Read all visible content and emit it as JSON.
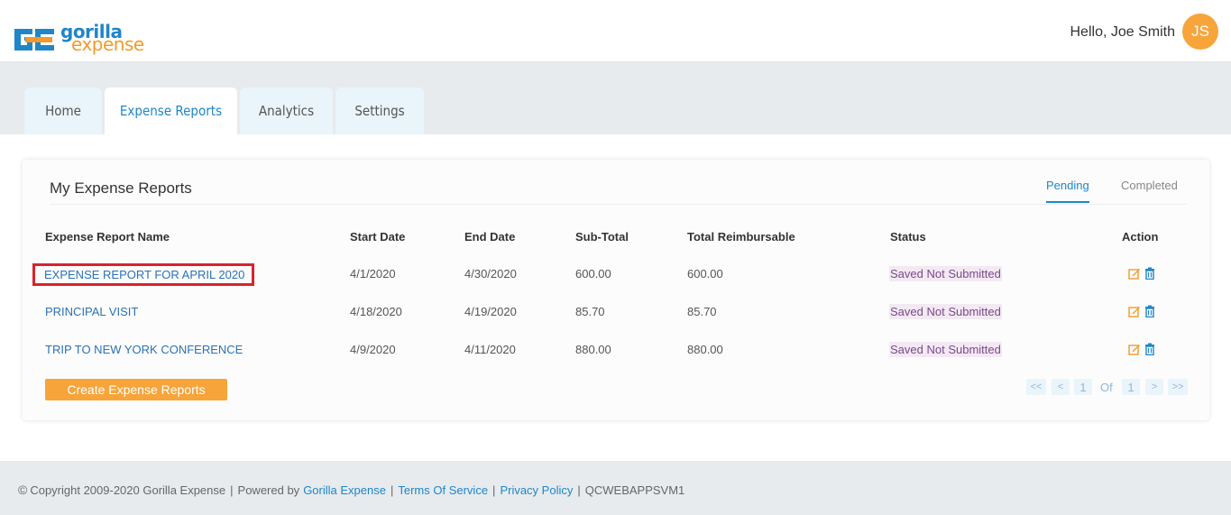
{
  "header": {
    "logo_top": "gorilla",
    "logo_bottom": "expense",
    "greeting": "Hello, Joe Smith",
    "avatar_initials": "JS"
  },
  "tabs": [
    {
      "label": "Home",
      "active": false
    },
    {
      "label": "Expense Reports",
      "active": true
    },
    {
      "label": "Analytics",
      "active": false
    },
    {
      "label": "Settings",
      "active": false
    }
  ],
  "card": {
    "title": "My Expense Reports",
    "status_tabs": {
      "pending": "Pending",
      "completed": "Completed"
    },
    "columns": [
      "Expense Report Name",
      "Start Date",
      "End Date",
      "Sub-Total",
      "Total Reimbursable",
      "Status",
      "Action"
    ],
    "rows": [
      {
        "name": "EXPENSE REPORT FOR APRIL 2020",
        "start": "4/1/2020",
        "end": "4/30/2020",
        "subtotal": "600.00",
        "total": "600.00",
        "status": "Saved Not Submitted"
      },
      {
        "name": "PRINCIPAL VISIT",
        "start": "4/18/2020",
        "end": "4/19/2020",
        "subtotal": "85.70",
        "total": "85.70",
        "status": "Saved Not Submitted"
      },
      {
        "name": "TRIP TO NEW YORK CONFERENCE",
        "start": "4/9/2020",
        "end": "4/11/2020",
        "subtotal": "880.00",
        "total": "880.00",
        "status": "Saved Not Submitted"
      }
    ],
    "create_button": "Create Expense Reports",
    "pagination": {
      "first": "<<",
      "prev": "<",
      "current": "1",
      "of": "Of",
      "total": "1",
      "next": ">",
      "last": ">>"
    }
  },
  "footer": {
    "copyright_symbol": "©",
    "copyright": "Copyright 2009-2020 Gorilla Expense",
    "powered_by": "Powered by",
    "powered_link": "Gorilla Expense",
    "terms": "Terms Of Service",
    "privacy": "Privacy Policy",
    "server": "QCWEBAPPSVM1",
    "separator": "|"
  },
  "colors": {
    "brand_blue": "#1f86c8",
    "brand_orange": "#f7a43a",
    "highlight_red": "#d9232f",
    "status_purple": "#7b4a8a"
  }
}
